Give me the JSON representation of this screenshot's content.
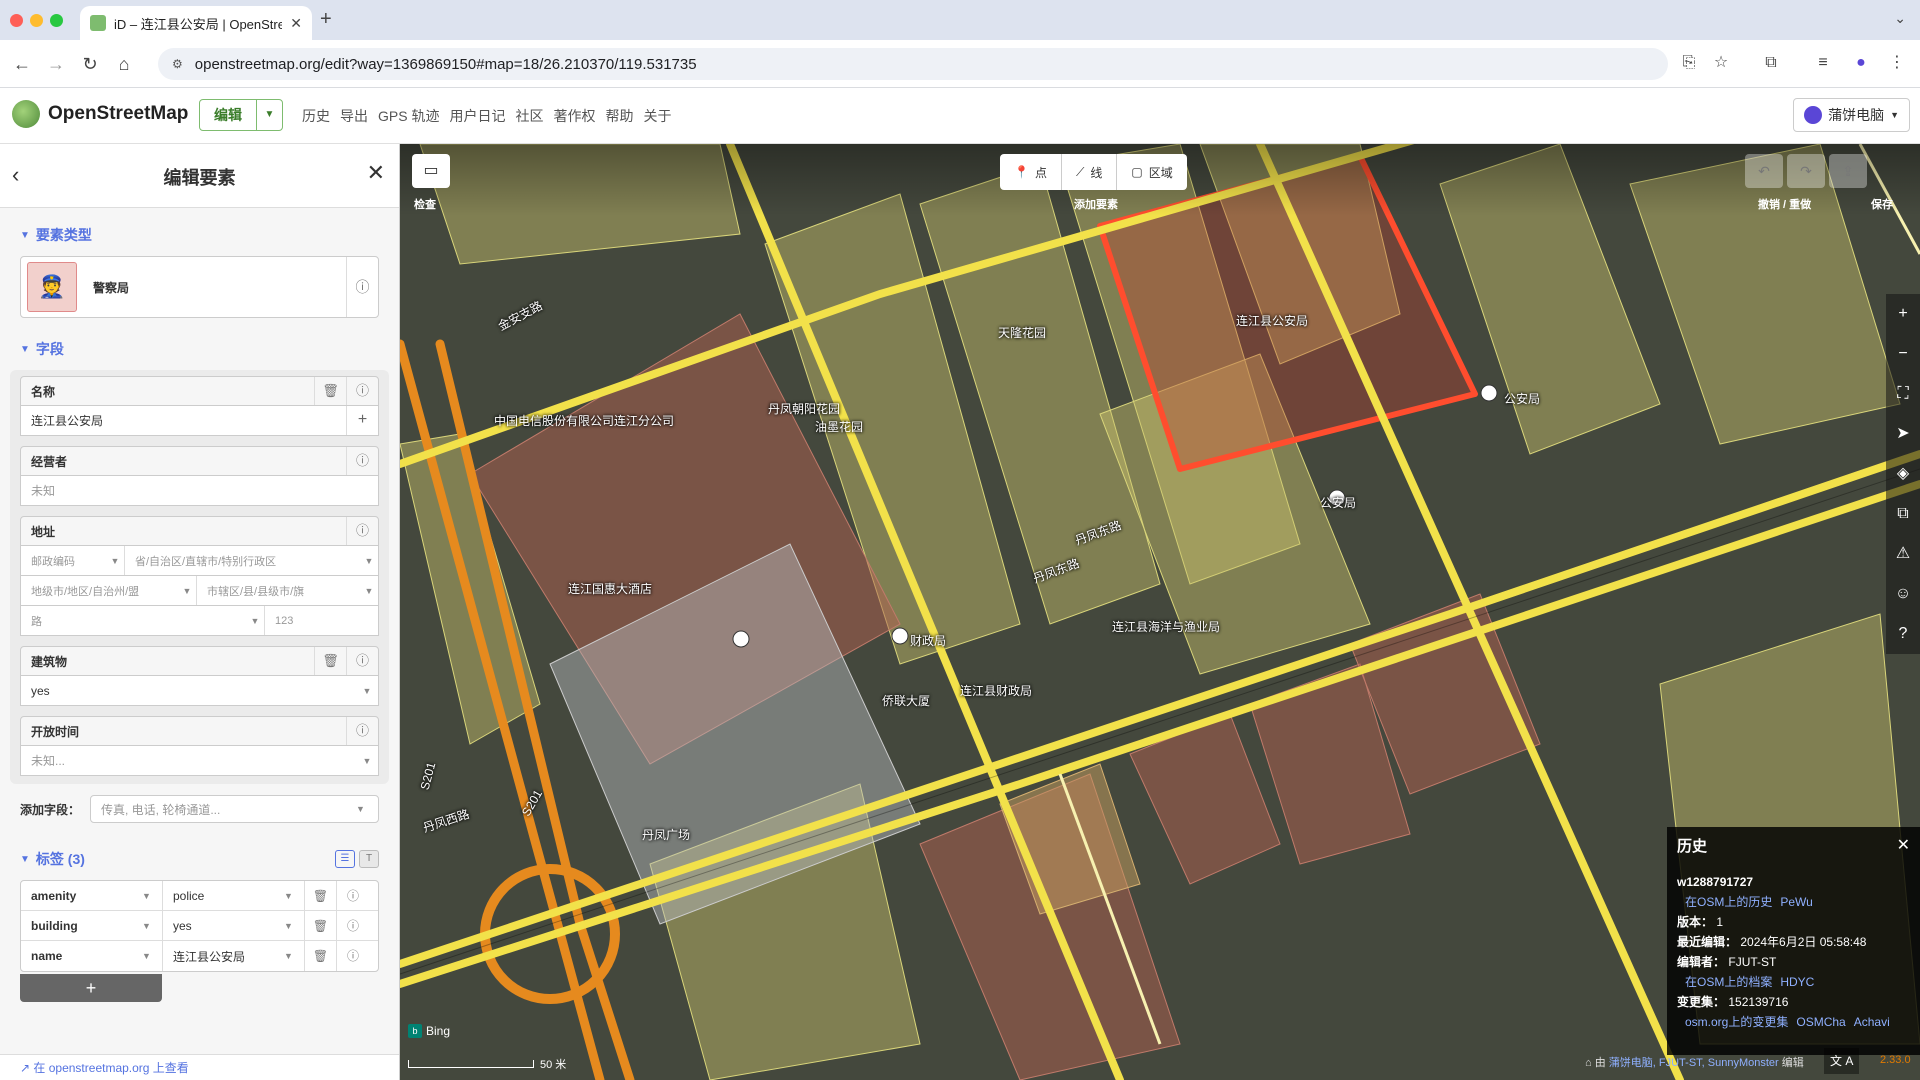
{
  "browser": {
    "tab_title": "iD – 连江县公安局 | OpenStree",
    "url": "openstreetmap.org/edit?way=1369869150#map=18/26.210370/119.531735"
  },
  "header": {
    "brand": "OpenStreetMap",
    "edit_label": "编辑",
    "nav": [
      "历史",
      "导出",
      "GPS 轨迹",
      "用户日记",
      "社区",
      "著作权",
      "帮助",
      "关于"
    ],
    "user_name": "蒲饼电脑"
  },
  "sidebar": {
    "title": "编辑要素",
    "feature_type_heading": "要素类型",
    "preset_name": "警察局",
    "fields_heading": "字段",
    "fields": {
      "name": {
        "label": "名称",
        "value": "连江县公安局"
      },
      "operator": {
        "label": "经营者",
        "placeholder": "未知"
      },
      "address": {
        "label": "地址",
        "postcode": "邮政编码",
        "province": "省/自治区/直辖市/特别行政区",
        "city": "地级市/地区/自治州/盟",
        "district": "市辖区/县/县级市/旗",
        "street": "路",
        "housenumber": "123"
      },
      "building": {
        "label": "建筑物",
        "value": "yes"
      },
      "opening_hours": {
        "label": "开放时间",
        "placeholder": "未知..."
      }
    },
    "add_field_label": "添加字段：",
    "add_field_placeholder": "传真, 电话, 轮椅通道...",
    "tags_heading": "标签 (3)",
    "tags": [
      {
        "key": "amenity",
        "value": "police"
      },
      {
        "key": "building",
        "value": "yes"
      },
      {
        "key": "name",
        "value": "连江县公安局"
      }
    ],
    "view_on_osm": "在 openstreetmap.org 上查看"
  },
  "map": {
    "inspect_label": "检查",
    "modes": [
      "点",
      "线",
      "区域"
    ],
    "add_feature_label": "添加要素",
    "undo_label": "撤销 / 重做",
    "save_label": "保存",
    "labels": {
      "police": "连江县公安局",
      "police_pin": "公安局",
      "bus_stop": "公安局",
      "tianlong": "天隆花园",
      "danfeng_yang": "丹凤朝阳花园",
      "yijing": "油墨花园",
      "telecom": "中国电信股份有限公司连江分公司",
      "hotel": "连江国惠大酒店",
      "finance_stop": "财政局",
      "finance": "连江县财政局",
      "fishery": "连江县海洋与渔业局",
      "overseas": "侨联大厦",
      "square": "丹凤广场",
      "road_jinan": "金安支路",
      "road_danfeng_e1": "丹凤东路",
      "road_danfeng_e2": "丹凤东路",
      "road_danfeng_w": "丹凤西路",
      "road_s201a": "S201",
      "road_s201b": "S201"
    },
    "attribution_source": "Bing",
    "scale": "50 米",
    "attribution_prefix": "由",
    "attribution_users": "蒲饼电脑, FJUT-ST, SunnyMonster",
    "attribution_suffix": "编辑",
    "language": "A",
    "version": "2.33.0"
  },
  "history": {
    "title": "历史",
    "id": "w1288791727",
    "osm_history_link": "在OSM上的历史",
    "osm_history_user": "PeWu",
    "version_key": "版本：",
    "version_val": "1",
    "last_edit_key": "最近编辑：",
    "last_edit_val": "2024年6月2日 05:58:48",
    "editor_key": "编辑者：",
    "editor_val": "FJUT-ST",
    "osm_profile_link": "在OSM上的档案",
    "osm_profile_user": "HDYC",
    "changeset_key": "变更集：",
    "changeset_val": "152139716",
    "changeset_link": "osm.org上的变更集",
    "osmcha": "OSMCha",
    "achavi": "Achavi"
  }
}
